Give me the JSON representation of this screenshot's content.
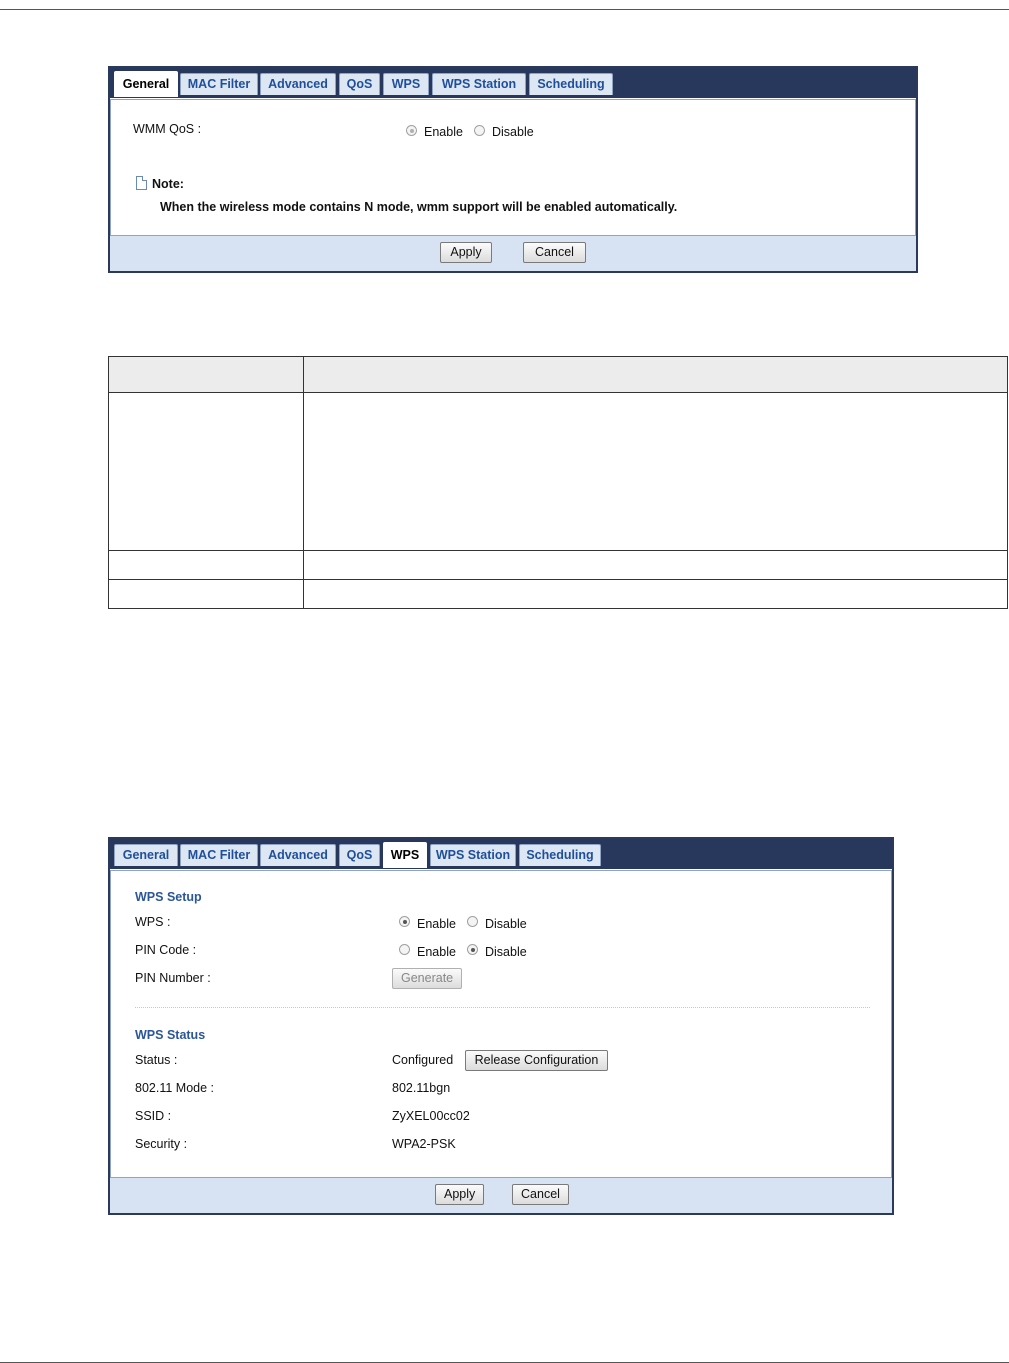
{
  "qos_panel": {
    "tabs": [
      "General",
      "MAC Filter",
      "Advanced",
      "QoS",
      "WPS",
      "WPS Station",
      "Scheduling"
    ],
    "active_tab": "QoS",
    "wmm_label": "WMM QoS :",
    "enable": "Enable",
    "disable": "Disable",
    "wmm_value": "Enable",
    "note_title": "Note:",
    "note_text": "When the wireless mode contains N mode, wmm support will be enabled automatically.",
    "apply": "Apply",
    "cancel": "Cancel"
  },
  "wps_panel": {
    "tabs": [
      "General",
      "MAC Filter",
      "Advanced",
      "QoS",
      "WPS",
      "WPS Station",
      "Scheduling"
    ],
    "active_tab": "WPS",
    "setup_title": "WPS Setup",
    "wps_label": "WPS :",
    "wps_value": "Enable",
    "pin_code_label": "PIN Code :",
    "pin_code_value": "Disable",
    "enable": "Enable",
    "disable": "Disable",
    "pin_number_label": "PIN Number :",
    "generate": "Generate",
    "status_title": "WPS Status",
    "status_label": "Status :",
    "status_value": "Configured",
    "release": "Release Configuration",
    "mode_label": "802.11 Mode :",
    "mode_value": "802.11bgn",
    "ssid_label": "SSID :",
    "ssid_value": "ZyXEL00cc02",
    "security_label": "Security :",
    "security_value": "WPA2-PSK",
    "apply": "Apply",
    "cancel": "Cancel"
  }
}
